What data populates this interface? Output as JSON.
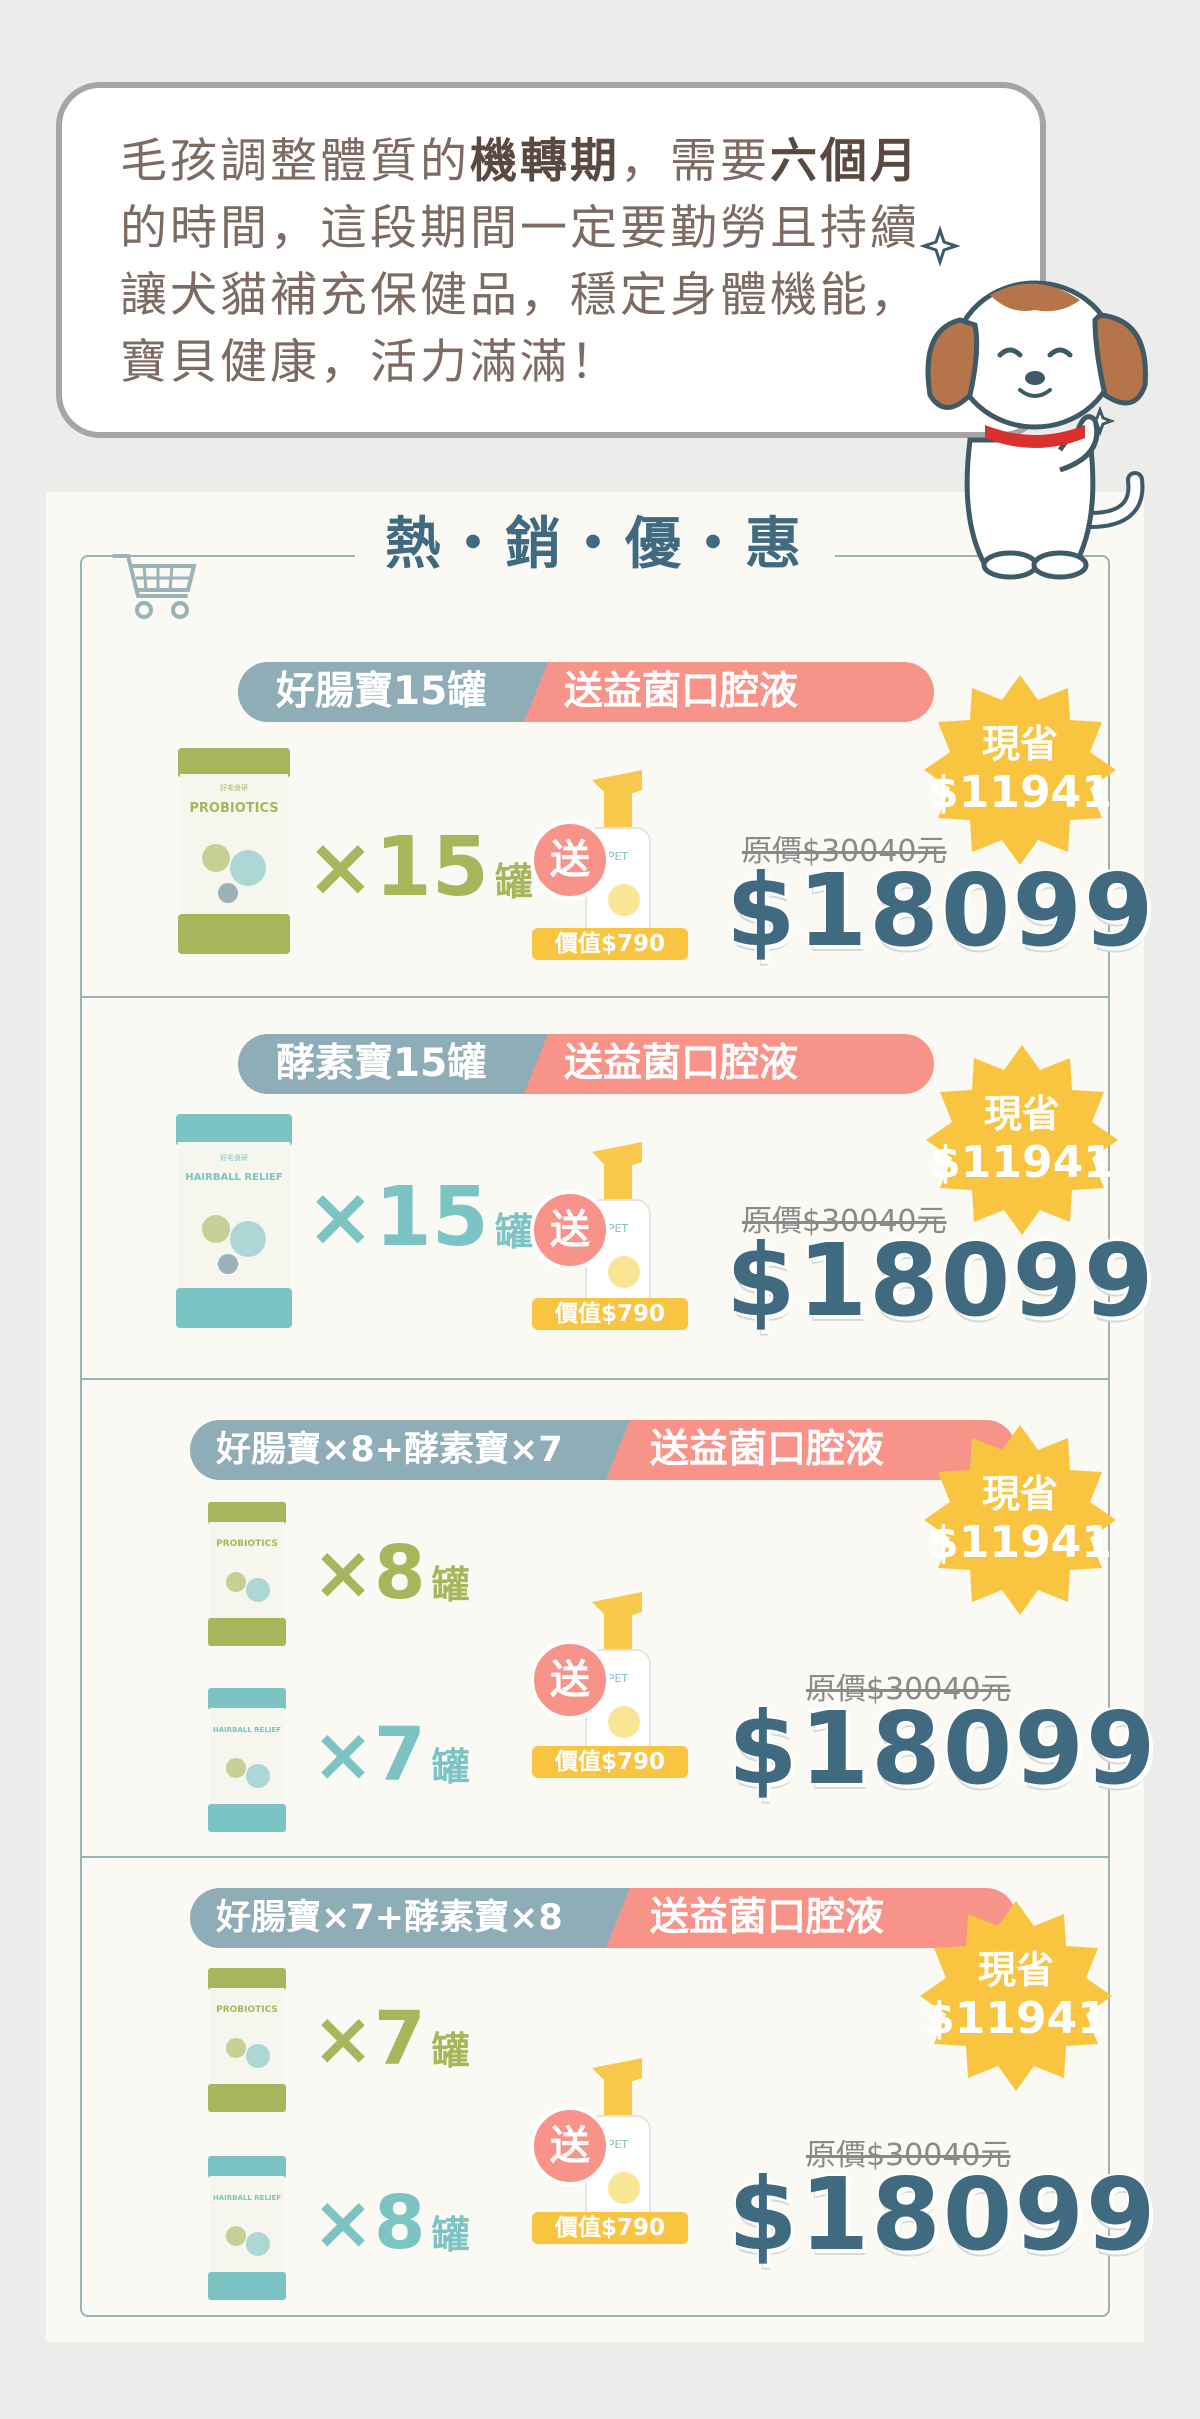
{
  "intro": {
    "line1_a": "毛孩調整體質的",
    "line1_b": "機轉期",
    "line1_c": "，需要",
    "line1_d": "六個月",
    "line2": "的時間，這段期間一定要勤勞且持續",
    "line3": "讓犬貓補充保健品，穩定身體機能，",
    "line4": "寶貝健康，活力滿滿！"
  },
  "section_title": "熱・銷・優・惠",
  "offers": [
    {
      "left_label": "好腸寶15罐",
      "right_label": "送益菌口腔液",
      "save_label": "現省",
      "save_amount": "$11941",
      "qty1": "×15",
      "unit": "罐",
      "gift": "送",
      "gift_value": "價值$790",
      "original_price": "原價$30040元",
      "price": "$18099"
    },
    {
      "left_label": "酵素寶15罐",
      "right_label": "送益菌口腔液",
      "save_label": "現省",
      "save_amount": "$11941",
      "qty1": "×15",
      "unit": "罐",
      "gift": "送",
      "gift_value": "價值$790",
      "original_price": "原價$30040元",
      "price": "$18099"
    },
    {
      "left_label": "好腸寶×8+酵素寶×7",
      "right_label": "送益菌口腔液",
      "save_label": "現省",
      "save_amount": "$11941",
      "qty1": "×8",
      "qty2": "×7",
      "unit": "罐",
      "gift": "送",
      "gift_value": "價值$790",
      "original_price": "原價$30040元",
      "price": "$18099"
    },
    {
      "left_label": "好腸寶×7+酵素寶×8",
      "right_label": "送益菌口腔液",
      "save_label": "現省",
      "save_amount": "$11941",
      "qty1": "×7",
      "qty2": "×8",
      "unit": "罐",
      "gift": "送",
      "gift_value": "價值$790",
      "original_price": "原價$30040元",
      "price": "$18099"
    }
  ],
  "colors": {
    "green_can": "#a9b55a",
    "teal_can": "#7cc3c3",
    "price_blue": "#3f6a80",
    "ribbon_gray": "#8fadb6",
    "ribbon_pink": "#f8938a",
    "burst_yellow": "#f9c440"
  }
}
